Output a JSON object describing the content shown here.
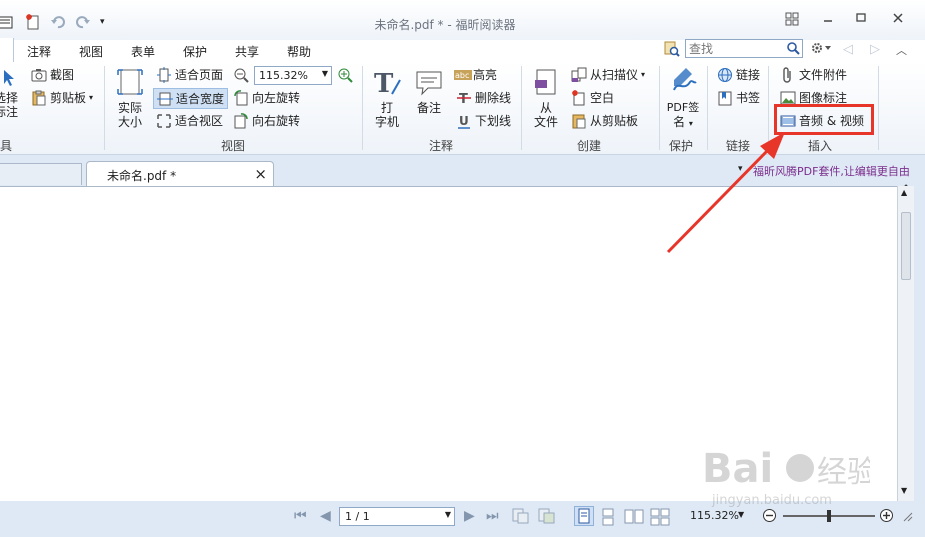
{
  "window": {
    "title": "未命名.pdf * - 福昕阅读器"
  },
  "tabs": [
    "注释",
    "视图",
    "表单",
    "保护",
    "共享",
    "帮助"
  ],
  "search": {
    "placeholder": "查找"
  },
  "ribbon": {
    "tools": {
      "select_label_a": "选择",
      "select_label_b": "标注",
      "screenshot": "截图",
      "clipboard": "剪贴板",
      "group": "具"
    },
    "view": {
      "actual_size_a": "实际",
      "actual_size_b": "大小",
      "fit_page": "适合页面",
      "fit_width": "适合宽度",
      "fit_visible": "适合视区",
      "zoom_value": "115.32%",
      "rotate_left": "向左旋转",
      "rotate_right": "向右旋转",
      "group": "视图"
    },
    "comment": {
      "typewriter_a": "打",
      "typewriter_b": "字机",
      "note": "备注",
      "highlight": "高亮",
      "strikeout": "删除线",
      "underline": "下划线",
      "group": "注释"
    },
    "create": {
      "from_file_a": "从",
      "from_file_b": "文件",
      "from_scanner": "从扫描仪",
      "blank": "空白",
      "from_clipboard": "从剪贴板",
      "group": "创建"
    },
    "protect": {
      "pdf_sign_a": "PDF签",
      "pdf_sign_b": "名",
      "group": "保护"
    },
    "links": {
      "link": "链接",
      "bookmark": "书签",
      "group": "链接"
    },
    "insert": {
      "file_attachment": "文件附件",
      "image_annotation": "图像标注",
      "audio_video": "音频 & 视频",
      "group": "插入"
    }
  },
  "doc_tab": {
    "name": "未命名.pdf *"
  },
  "promo_text": "福昕风腾PDF套件,让编辑更自由",
  "statusbar": {
    "page": "1 / 1",
    "zoom": "115.32%"
  },
  "colors": {
    "highlight_box": "#e8352a",
    "promo": "#7b2d8c"
  }
}
